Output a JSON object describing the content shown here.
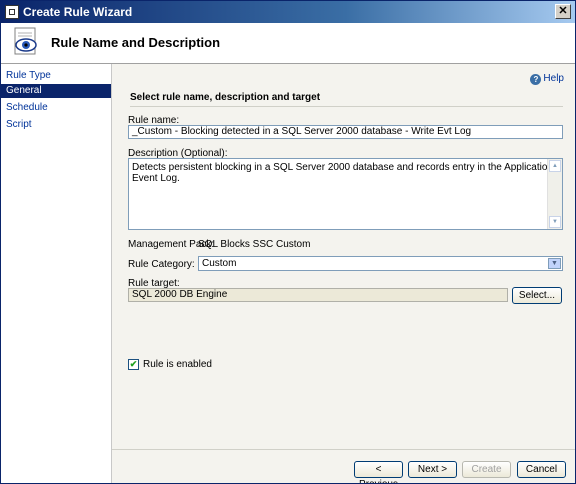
{
  "window": {
    "title": "Create Rule Wizard",
    "close_glyph": "✕"
  },
  "header": {
    "title": "Rule Name and Description"
  },
  "sidebar": {
    "items": [
      {
        "label": "Rule Type"
      },
      {
        "label": "General"
      },
      {
        "label": "Schedule"
      },
      {
        "label": "Script"
      }
    ]
  },
  "help": {
    "label": "Help",
    "glyph": "?"
  },
  "form": {
    "section_title": "Select rule name, description and target",
    "rule_name_label": "Rule name:",
    "rule_name_value": "_Custom - Blocking detected in a SQL Server 2000 database - Write Evt Log",
    "description_label": "Description (Optional):",
    "description_value": "Detects persistent blocking in a SQL Server 2000 database and records entry in the Application Event Log.",
    "management_pack_label": "Management Pack:",
    "management_pack_value": "SQL Blocks SSC Custom",
    "rule_category_label": "Rule Category:",
    "rule_category_value": "Custom",
    "rule_target_label": "Rule target:",
    "rule_target_value": "SQL 2000 DB Engine",
    "select_button": "Select...",
    "enabled_label": "Rule is enabled",
    "enabled_checked": true
  },
  "buttons": {
    "previous": "< Previous",
    "next": "Next >",
    "create": "Create",
    "cancel": "Cancel"
  },
  "glyphs": {
    "up": "▲",
    "down": "▼",
    "check": "✔"
  }
}
